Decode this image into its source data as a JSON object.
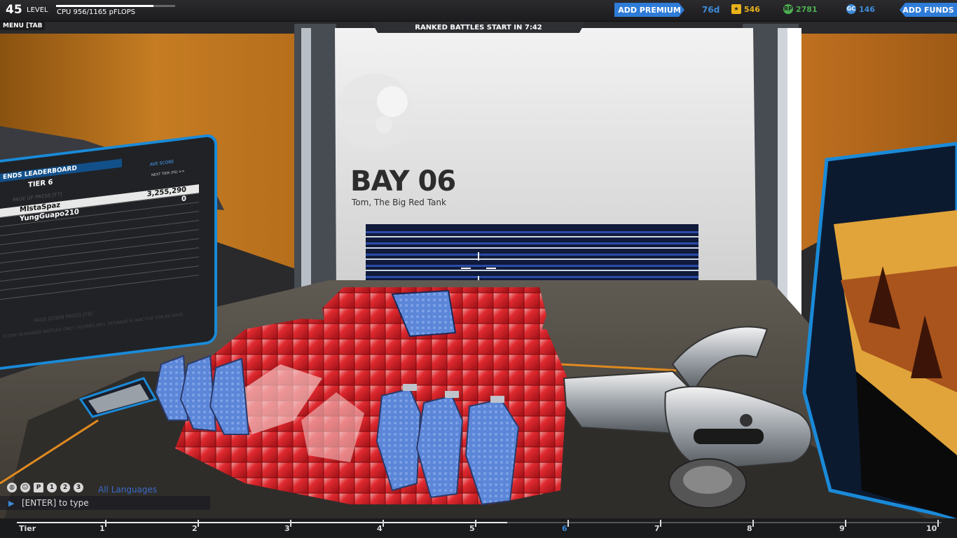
{
  "player": {
    "level": "45",
    "level_label": "LEVEL",
    "cpu": "CPU 956/1165 pFLOPS",
    "cpu_fill": 0.82
  },
  "menu_tab": "MENU [TAB",
  "premium": {
    "button": "ADD PREMIUM",
    "days": "76d"
  },
  "currency": {
    "stars": "546",
    "rp": "2781",
    "gc": "146",
    "add_funds": "ADD FUNDS"
  },
  "currency_icons": {
    "stars": "RP",
    "rp": "RP",
    "gc": "GC"
  },
  "ranked_banner": "RANKED BATTLES START IN 7:42",
  "bay": {
    "title": "BAY 06",
    "robot_name": "Tom, The Big Red Tank"
  },
  "leaderboard": {
    "title": "ENDS LEADERBOARD",
    "tier": "TIER 6",
    "score_header": "AVE SCORE",
    "next_tier": "NEXT TIER (F6) >>",
    "page_up": "PAGE UP PRESS [F7]",
    "page_down": "PAGE DOWN PRESS [F8]",
    "note": "SCORE IN RANKED BATTLES ONLY / SCORES WILL DEGRADE IF INACTIVE FOR 60 DAYS",
    "rows": [
      {
        "name": "MIstaSpaz",
        "score": "3,255,290"
      },
      {
        "name": "YungGuapo210",
        "score": "0"
      }
    ]
  },
  "chat": {
    "icons": [
      "globe-icon",
      "person-icon",
      "p-icon",
      "1-icon",
      "2-icon",
      "3-icon"
    ],
    "channel": "All Languages",
    "prompt": "[ENTER] to type"
  },
  "tiers": {
    "label": "Tier",
    "items": [
      "1",
      "2",
      "3",
      "4",
      "5",
      "6",
      "7",
      "8",
      "9",
      "10"
    ],
    "active": "6"
  },
  "colors": {
    "accent": "#2f7cd8",
    "robot_red": "#d8232a",
    "hub_orange": "#c5781c"
  }
}
